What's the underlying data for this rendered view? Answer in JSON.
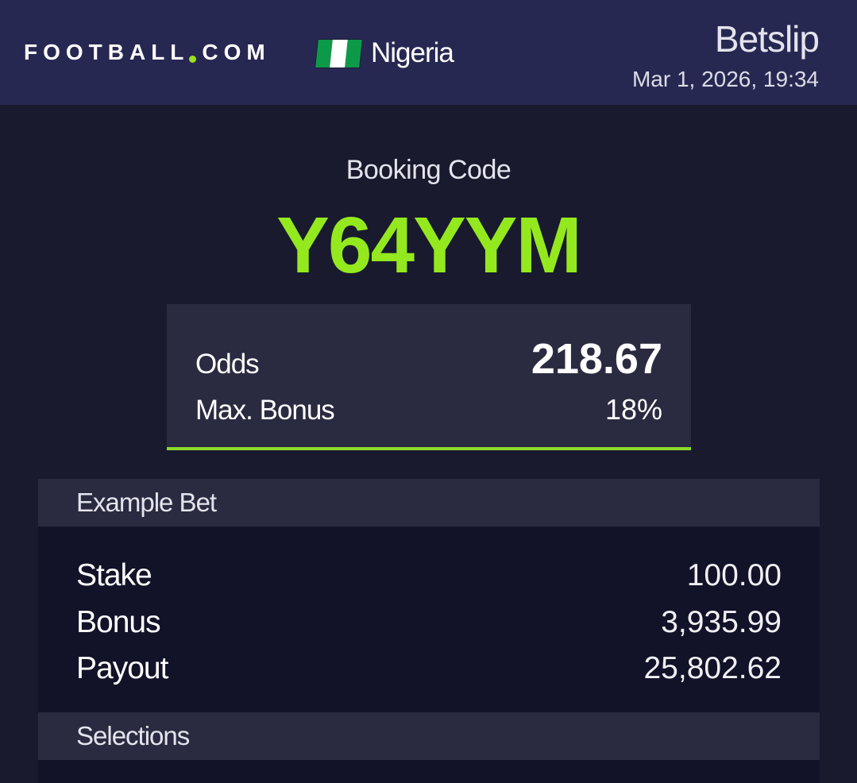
{
  "header": {
    "brand": {
      "name": "FOOTBALL",
      "suffix": "COM"
    },
    "country": "Nigeria",
    "title": "Betslip",
    "datetime": "Mar 1, 2026, 19:34"
  },
  "booking": {
    "label": "Booking Code",
    "code": "Y64YYM"
  },
  "odds_card": {
    "odds_label": "Odds",
    "odds_value": "218.67",
    "bonus_label": "Max. Bonus",
    "bonus_value": "18%"
  },
  "example_bet": {
    "heading": "Example Bet",
    "rows": [
      {
        "label": "Stake",
        "value": "100.00"
      },
      {
        "label": "Bonus",
        "value": "3,935.99"
      },
      {
        "label": "Payout",
        "value": "25,802.62"
      }
    ]
  },
  "selections": {
    "heading": "Selections"
  },
  "colors": {
    "header_bg": "#272852",
    "page_bg": "#1a1a2e",
    "accent_green": "#93e91e",
    "card_bg": "#2a2a40",
    "flag_green": "#0d9a48"
  }
}
